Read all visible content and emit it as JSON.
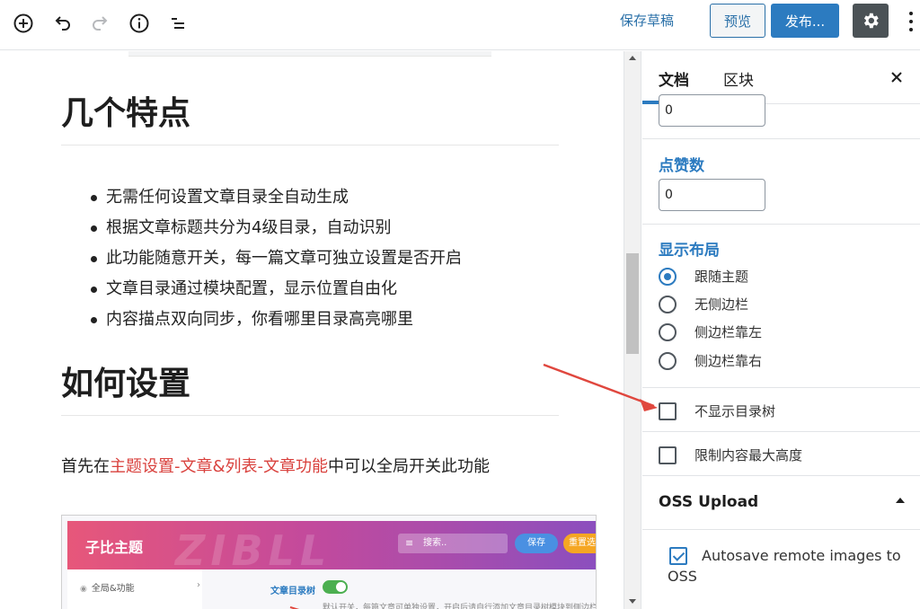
{
  "toolbar": {
    "add_icon": "plus-circle-icon",
    "undo_icon": "undo-icon",
    "redo_icon": "redo-icon",
    "info_icon": "info-icon",
    "outline_icon": "list-view-icon",
    "save_draft_label": "保存草稿",
    "preview_label": "预览",
    "publish_label": "发布...",
    "settings_icon": "gear-icon",
    "more_icon": "more-vertical-icon"
  },
  "editor": {
    "heading1": "几个特点",
    "features": [
      "无需任何设置文章目录全自动生成",
      "根据文章标题共分为4级目录，自动识别",
      "此功能随意开关，每一篇文章可独立设置是否开启",
      "文章目录通过模块配置，显示位置自由化",
      "内容描点双向同步，你看哪里目录高亮哪里"
    ],
    "heading2": "如何设置",
    "paragraph": {
      "prefix": "首先在",
      "highlight": "主题设置-文章&列表-文章功能",
      "suffix": "中可以全局开关此功能"
    },
    "screenshot": {
      "title": "子比主题",
      "watermark": "ZIBLL",
      "search_placeholder": "搜索..",
      "save_label": "保存",
      "reset_label": "重置选",
      "sidebar_item": "全局&功能",
      "option_label": "文章目录树",
      "option_desc": "默认开关，每篇文章可单独设置，开启后请自行添加文章目录树模块到侧边栏"
    }
  },
  "sidebar": {
    "tabs": [
      {
        "label": "文档",
        "active": true
      },
      {
        "label": "区块",
        "active": false
      }
    ],
    "close_icon": "close-icon",
    "field_top_value": "0",
    "likes": {
      "label": "点赞数",
      "value": "0"
    },
    "layout": {
      "label": "显示布局",
      "options": [
        {
          "label": "跟随主题",
          "checked": true
        },
        {
          "label": "无侧边栏",
          "checked": false
        },
        {
          "label": "侧边栏靠左",
          "checked": false
        },
        {
          "label": "侧边栏靠右",
          "checked": false
        }
      ]
    },
    "checkboxes": [
      {
        "label": "不显示目录树",
        "checked": false
      },
      {
        "label": "限制内容最大高度",
        "checked": false
      }
    ],
    "oss": {
      "title": "OSS Upload",
      "autosave_label": "Autosave remote images to OSS",
      "autosave_checked": true
    }
  },
  "colors": {
    "accent": "#2c7bc0",
    "highlight_text": "#d9413d",
    "annotation_arrow": "#e0473e"
  }
}
